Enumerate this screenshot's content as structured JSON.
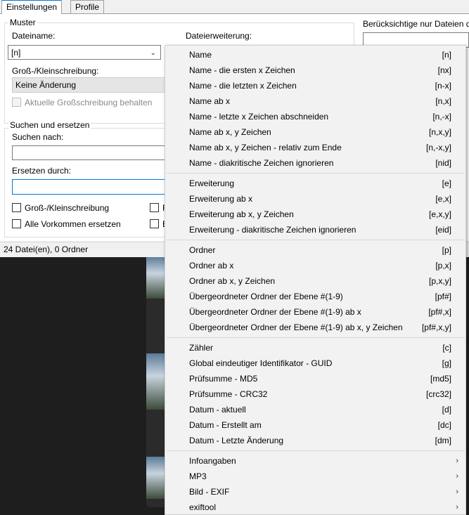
{
  "tabs": [
    {
      "label": "Einstellungen"
    },
    {
      "label": "Profile"
    }
  ],
  "muster": {
    "title": "Muster",
    "dateiname_label": "Dateiname:",
    "dateiname_value": "[n]",
    "dateierweiterung_label": "Dateierweiterung:",
    "case_label": "Groß-/Kleinschreibung:",
    "case_value": "Keine Änderung",
    "keep_caps_label": "Aktuelle Großschreibung behalten"
  },
  "right_panel": {
    "label": "Berücksichtige nur Dateien d"
  },
  "search_replace": {
    "title": "Suchen und ersetzen",
    "search_label": "Suchen nach:",
    "search_value": "",
    "replace_label": "Ersetzen durch:",
    "replace_value": "",
    "case_sensitive_label": "Groß-/Kleinschreibung",
    "replace_all_label": "Alle Vorkommen ersetzen",
    "clipped_label_1": "R",
    "clipped_label_2": "E"
  },
  "status": {
    "text": "24 Datei(en), 0 Ordner"
  },
  "menu": {
    "groups": [
      [
        {
          "label": "Name",
          "key": "[n]"
        },
        {
          "label": "Name - die ersten x Zeichen",
          "key": "[nx]"
        },
        {
          "label": "Name - die letzten x Zeichen",
          "key": "[n-x]"
        },
        {
          "label": "Name ab x",
          "key": "[n,x]"
        },
        {
          "label": "Name - letzte x Zeichen abschneiden",
          "key": "[n,-x]"
        },
        {
          "label": "Name ab x, y Zeichen",
          "key": "[n,x,y]"
        },
        {
          "label": "Name ab x, y Zeichen - relativ zum Ende",
          "key": "[n,-x,y]"
        },
        {
          "label": "Name - diakritische Zeichen ignorieren",
          "key": "[nid]"
        }
      ],
      [
        {
          "label": "Erweiterung",
          "key": "[e]"
        },
        {
          "label": "Erweiterung ab x",
          "key": "[e,x]"
        },
        {
          "label": "Erweiterung ab x, y Zeichen",
          "key": "[e,x,y]"
        },
        {
          "label": "Erweiterung - diakritische Zeichen ignorieren",
          "key": "[eid]"
        }
      ],
      [
        {
          "label": "Ordner",
          "key": "[p]"
        },
        {
          "label": "Ordner ab x",
          "key": "[p,x]"
        },
        {
          "label": "Ordner ab x, y Zeichen",
          "key": "[p,x,y]"
        },
        {
          "label": "Übergeordneter Ordner der Ebene #(1-9)",
          "key": "[pf#]"
        },
        {
          "label": "Übergeordneter Ordner der Ebene #(1-9) ab x",
          "key": "[pf#,x]"
        },
        {
          "label": "Übergeordneter Ordner der Ebene #(1-9) ab x, y Zeichen",
          "key": "[pf#,x,y]"
        }
      ],
      [
        {
          "label": "Zähler",
          "key": "[c]"
        },
        {
          "label": "Global eindeutiger Identifikator - GUID",
          "key": "[g]"
        },
        {
          "label": "Prüfsumme - MD5",
          "key": "[md5]"
        },
        {
          "label": "Prüfsumme - CRC32",
          "key": "[crc32]"
        },
        {
          "label": "Datum - aktuell",
          "key": "[d]"
        },
        {
          "label": "Datum - Erstellt am",
          "key": "[dc]"
        },
        {
          "label": "Datum - Letzte Änderung",
          "key": "[dm]"
        }
      ],
      [
        {
          "label": "Infoangaben",
          "submenu": true
        },
        {
          "label": "MP3",
          "submenu": true
        },
        {
          "label": "Bild - EXIF",
          "submenu": true
        },
        {
          "label": "exiftool",
          "submenu": true
        }
      ]
    ]
  },
  "icons": {
    "dropdown_arrow": "chevron-down-icon",
    "submenu_arrow": "chevron-right-icon"
  },
  "colors": {
    "accent": "#0078d7",
    "menu_bg": "#f2f2f2",
    "window_bg": "#f0f0f0"
  }
}
